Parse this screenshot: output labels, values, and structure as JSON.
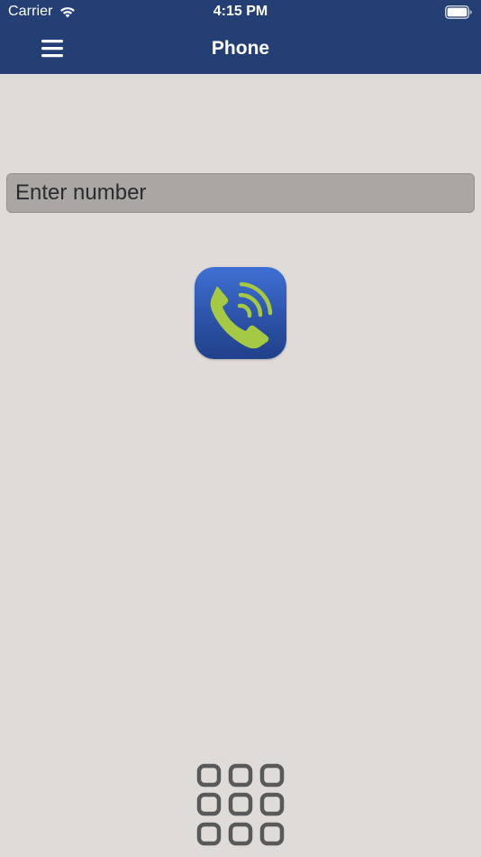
{
  "status_bar": {
    "carrier": "Carrier",
    "time": "4:15 PM",
    "wifi_icon": "wifi-icon",
    "battery_icon": "battery-icon"
  },
  "nav": {
    "title": "Phone",
    "menu_icon": "hamburger-menu-icon"
  },
  "dialer": {
    "number_placeholder": "Enter number",
    "number_value": "",
    "call_icon": "phone-call-icon",
    "keypad_icon": "keypad-grid-icon"
  },
  "colors": {
    "header_bg": "#243f73",
    "page_bg": "#dedbd9",
    "input_bg": "#a9a6a3",
    "call_button_blue": "#2d53a8",
    "call_icon_green": "#a5c845"
  }
}
